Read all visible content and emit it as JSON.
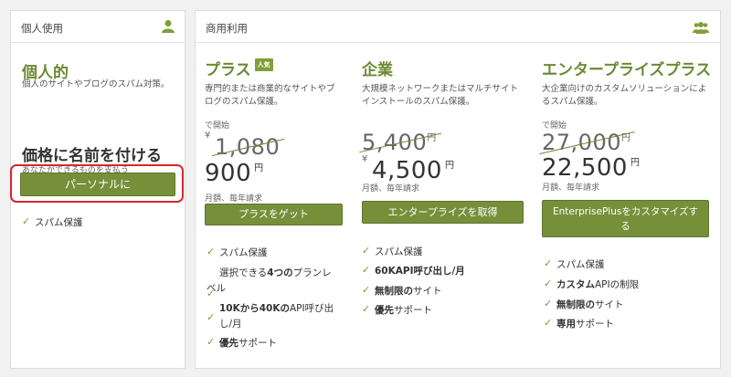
{
  "personal": {
    "header": "個人使用",
    "plan_name": "個人的",
    "plan_desc": "個人のサイトやブログのスパム対策。",
    "name_price_heading": "価格に名前を付ける",
    "name_price_sub": "あなたができるものを支払う",
    "button_label": "パーソナルに",
    "features": [
      "スパム保護"
    ]
  },
  "commercial": {
    "header": "商用利用",
    "plans": [
      {
        "name": "プラス",
        "badge": "人気",
        "desc_line1": "専門的または商業的なサイトやブ",
        "desc_line2": "ログのスパム保護。",
        "starting_label": "で開始",
        "currency": "¥",
        "old_price": "1,080",
        "new_price": "900",
        "unit": "円",
        "billing": "月額、毎年請求",
        "button_label": "プラスをゲット",
        "features": [
          {
            "text": "スパム保護"
          },
          {
            "line1": "選択できる",
            "bold": "4つの",
            "line1_rest": "プランレ",
            "line2": "ベル"
          },
          {
            "bold": "10Kから40Kの",
            "line1_rest": "API呼び出",
            "line2": "し/月"
          },
          {
            "bold": "優先",
            "rest": "サポート"
          }
        ]
      },
      {
        "name": "企業",
        "desc_line1": "大規模ネットワークまたはマルチサイト",
        "desc_line2": "インストールのスパム保護。",
        "currency": "¥",
        "old_price": "5,400",
        "old_unit": "円",
        "new_price": "4,500",
        "unit": "円",
        "billing": "月額、毎年請求",
        "button_label": "エンタープライズを取得",
        "features": [
          {
            "text": "スパム保護"
          },
          {
            "bold": "60KAPI呼び出し/月"
          },
          {
            "bold": "無制限の",
            "rest": "サイト"
          },
          {
            "bold": "優先",
            "rest": "サポート"
          }
        ]
      },
      {
        "name": "エンタープライズプラス",
        "desc_line1": "大企業向けのカスタムソリューションによ",
        "desc_line2": "るスパム保護。",
        "starting_label": "で開始",
        "old_price": "27,000",
        "old_unit": "円",
        "new_price": "22,500",
        "unit": "円",
        "billing": "月額、毎年請求",
        "button_line1": "EnterprisePlusをカスタマイズす",
        "button_line2": "る",
        "features": [
          {
            "text": "スパム保護"
          },
          {
            "bold": "カスタム",
            "rest": "APIの制限"
          },
          {
            "bold": "無制限の",
            "rest": "サイト"
          },
          {
            "bold": "専用",
            "rest": "サポート"
          }
        ]
      }
    ]
  },
  "colors": {
    "accent": "#76903a",
    "title_green": "#6b8a33",
    "highlight_red": "#d9262b"
  },
  "icons": {
    "personal": "user-icon",
    "commercial": "users-group-icon",
    "feature": "check-icon"
  }
}
